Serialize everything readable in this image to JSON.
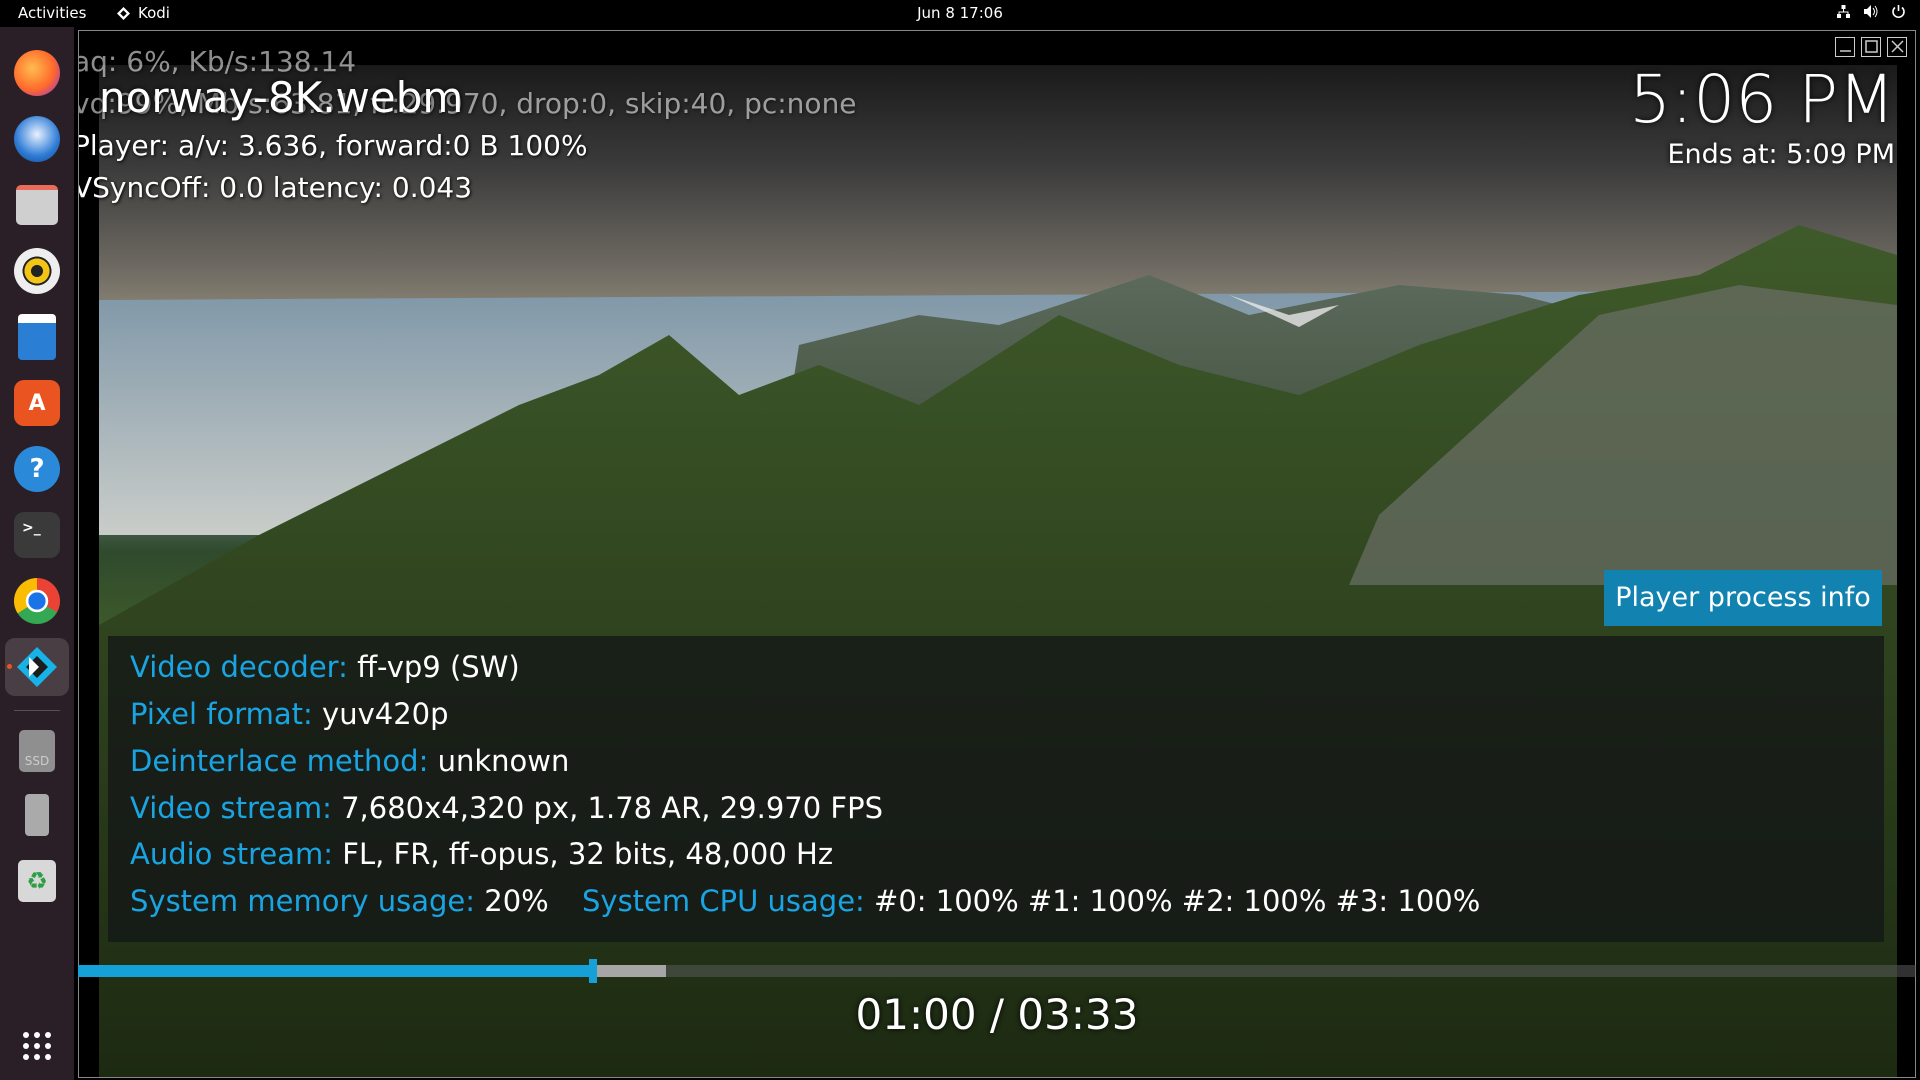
{
  "topbar": {
    "activities": "Activities",
    "app_name": "Kodi",
    "app_icon": "kodi-diamond-icon",
    "datetime": "Jun 8  17:06",
    "tray_icons": [
      "network-icon",
      "volume-icon",
      "power-icon"
    ]
  },
  "dock": {
    "items": [
      {
        "name": "firefox",
        "icon": "firefox-icon"
      },
      {
        "name": "thunderbird",
        "icon": "thunderbird-icon"
      },
      {
        "name": "files",
        "icon": "files-icon"
      },
      {
        "name": "rhythmbox",
        "icon": "rhythmbox-icon"
      },
      {
        "name": "libreoffice-writer",
        "icon": "writer-icon"
      },
      {
        "name": "app-center",
        "icon": "app-center-icon",
        "glyph": "A"
      },
      {
        "name": "help",
        "icon": "help-icon",
        "glyph": "?"
      },
      {
        "name": "terminal",
        "icon": "terminal-icon",
        "glyph": ">_"
      },
      {
        "name": "chrome",
        "icon": "chrome-icon"
      },
      {
        "name": "kodi",
        "icon": "kodi-icon",
        "active": true
      },
      {
        "name": "ssd",
        "icon": "ssd-drive-icon",
        "glyph": "SSD"
      },
      {
        "name": "usb",
        "icon": "usb-drive-icon"
      },
      {
        "name": "trash",
        "icon": "trash-icon",
        "glyph": "♻"
      }
    ],
    "show_apps_icon": "app-grid-icon"
  },
  "player": {
    "file_title": "norway-8K.webm",
    "debug_lines": [
      "aq:  6%, Kb/s:138.14",
      "vq:99%, Mb/s:63.81, fr:29.970, drop:0, skip:40, pc:none",
      "Player: a/v: 3.636,  forward:0 B 100%",
      "VSyncOff: 0.0 latency: 0.043"
    ],
    "clock": "5:06 PM",
    "ends_at": "Ends at: 5:09 PM",
    "process_info_button": "Player process info",
    "info": {
      "video_decoder_label": "Video decoder:",
      "video_decoder_value": "ff-vp9 (SW)",
      "pixel_format_label": "Pixel format:",
      "pixel_format_value": "yuv420p",
      "deinterlace_label": "Deinterlace method:",
      "deinterlace_value": "unknown",
      "video_stream_label": "Video stream:",
      "video_stream_value": "7,680x4,320 px, 1.78 AR, 29.970 FPS",
      "audio_stream_label": "Audio stream:",
      "audio_stream_value": "FL, FR, ff-opus, 32 bits, 48,000 Hz",
      "memory_label": "System memory usage:",
      "memory_value": "20%",
      "cpu_label": "System CPU usage:",
      "cpu_value": "#0: 100% #1: 100% #2: 100% #3: 100%"
    },
    "progress_fraction": 0.28,
    "buffer_fraction": 0.32,
    "timecode": "01:00 / 03:33"
  },
  "colors": {
    "accent": "#16a0d8",
    "label_blue": "#19a5e3",
    "button_blue": "#1283b0",
    "dock_bg": "#2a1f26"
  }
}
